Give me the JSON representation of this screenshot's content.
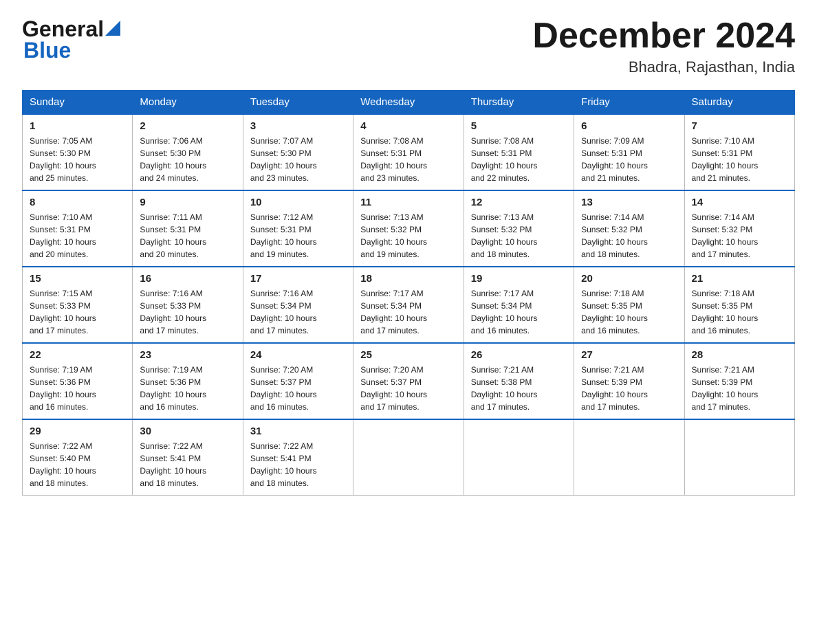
{
  "header": {
    "logo_general": "General",
    "logo_blue": "Blue",
    "month_title": "December 2024",
    "location": "Bhadra, Rajasthan, India"
  },
  "days_of_week": [
    "Sunday",
    "Monday",
    "Tuesday",
    "Wednesday",
    "Thursday",
    "Friday",
    "Saturday"
  ],
  "weeks": [
    [
      {
        "day": "1",
        "sunrise": "7:05 AM",
        "sunset": "5:30 PM",
        "daylight": "10 hours and 25 minutes."
      },
      {
        "day": "2",
        "sunrise": "7:06 AM",
        "sunset": "5:30 PM",
        "daylight": "10 hours and 24 minutes."
      },
      {
        "day": "3",
        "sunrise": "7:07 AM",
        "sunset": "5:30 PM",
        "daylight": "10 hours and 23 minutes."
      },
      {
        "day": "4",
        "sunrise": "7:08 AM",
        "sunset": "5:31 PM",
        "daylight": "10 hours and 23 minutes."
      },
      {
        "day": "5",
        "sunrise": "7:08 AM",
        "sunset": "5:31 PM",
        "daylight": "10 hours and 22 minutes."
      },
      {
        "day": "6",
        "sunrise": "7:09 AM",
        "sunset": "5:31 PM",
        "daylight": "10 hours and 21 minutes."
      },
      {
        "day": "7",
        "sunrise": "7:10 AM",
        "sunset": "5:31 PM",
        "daylight": "10 hours and 21 minutes."
      }
    ],
    [
      {
        "day": "8",
        "sunrise": "7:10 AM",
        "sunset": "5:31 PM",
        "daylight": "10 hours and 20 minutes."
      },
      {
        "day": "9",
        "sunrise": "7:11 AM",
        "sunset": "5:31 PM",
        "daylight": "10 hours and 20 minutes."
      },
      {
        "day": "10",
        "sunrise": "7:12 AM",
        "sunset": "5:31 PM",
        "daylight": "10 hours and 19 minutes."
      },
      {
        "day": "11",
        "sunrise": "7:13 AM",
        "sunset": "5:32 PM",
        "daylight": "10 hours and 19 minutes."
      },
      {
        "day": "12",
        "sunrise": "7:13 AM",
        "sunset": "5:32 PM",
        "daylight": "10 hours and 18 minutes."
      },
      {
        "day": "13",
        "sunrise": "7:14 AM",
        "sunset": "5:32 PM",
        "daylight": "10 hours and 18 minutes."
      },
      {
        "day": "14",
        "sunrise": "7:14 AM",
        "sunset": "5:32 PM",
        "daylight": "10 hours and 17 minutes."
      }
    ],
    [
      {
        "day": "15",
        "sunrise": "7:15 AM",
        "sunset": "5:33 PM",
        "daylight": "10 hours and 17 minutes."
      },
      {
        "day": "16",
        "sunrise": "7:16 AM",
        "sunset": "5:33 PM",
        "daylight": "10 hours and 17 minutes."
      },
      {
        "day": "17",
        "sunrise": "7:16 AM",
        "sunset": "5:34 PM",
        "daylight": "10 hours and 17 minutes."
      },
      {
        "day": "18",
        "sunrise": "7:17 AM",
        "sunset": "5:34 PM",
        "daylight": "10 hours and 17 minutes."
      },
      {
        "day": "19",
        "sunrise": "7:17 AM",
        "sunset": "5:34 PM",
        "daylight": "10 hours and 16 minutes."
      },
      {
        "day": "20",
        "sunrise": "7:18 AM",
        "sunset": "5:35 PM",
        "daylight": "10 hours and 16 minutes."
      },
      {
        "day": "21",
        "sunrise": "7:18 AM",
        "sunset": "5:35 PM",
        "daylight": "10 hours and 16 minutes."
      }
    ],
    [
      {
        "day": "22",
        "sunrise": "7:19 AM",
        "sunset": "5:36 PM",
        "daylight": "10 hours and 16 minutes."
      },
      {
        "day": "23",
        "sunrise": "7:19 AM",
        "sunset": "5:36 PM",
        "daylight": "10 hours and 16 minutes."
      },
      {
        "day": "24",
        "sunrise": "7:20 AM",
        "sunset": "5:37 PM",
        "daylight": "10 hours and 16 minutes."
      },
      {
        "day": "25",
        "sunrise": "7:20 AM",
        "sunset": "5:37 PM",
        "daylight": "10 hours and 17 minutes."
      },
      {
        "day": "26",
        "sunrise": "7:21 AM",
        "sunset": "5:38 PM",
        "daylight": "10 hours and 17 minutes."
      },
      {
        "day": "27",
        "sunrise": "7:21 AM",
        "sunset": "5:39 PM",
        "daylight": "10 hours and 17 minutes."
      },
      {
        "day": "28",
        "sunrise": "7:21 AM",
        "sunset": "5:39 PM",
        "daylight": "10 hours and 17 minutes."
      }
    ],
    [
      {
        "day": "29",
        "sunrise": "7:22 AM",
        "sunset": "5:40 PM",
        "daylight": "10 hours and 18 minutes."
      },
      {
        "day": "30",
        "sunrise": "7:22 AM",
        "sunset": "5:41 PM",
        "daylight": "10 hours and 18 minutes."
      },
      {
        "day": "31",
        "sunrise": "7:22 AM",
        "sunset": "5:41 PM",
        "daylight": "10 hours and 18 minutes."
      },
      null,
      null,
      null,
      null
    ]
  ],
  "labels": {
    "sunrise": "Sunrise:",
    "sunset": "Sunset:",
    "daylight": "Daylight:"
  }
}
